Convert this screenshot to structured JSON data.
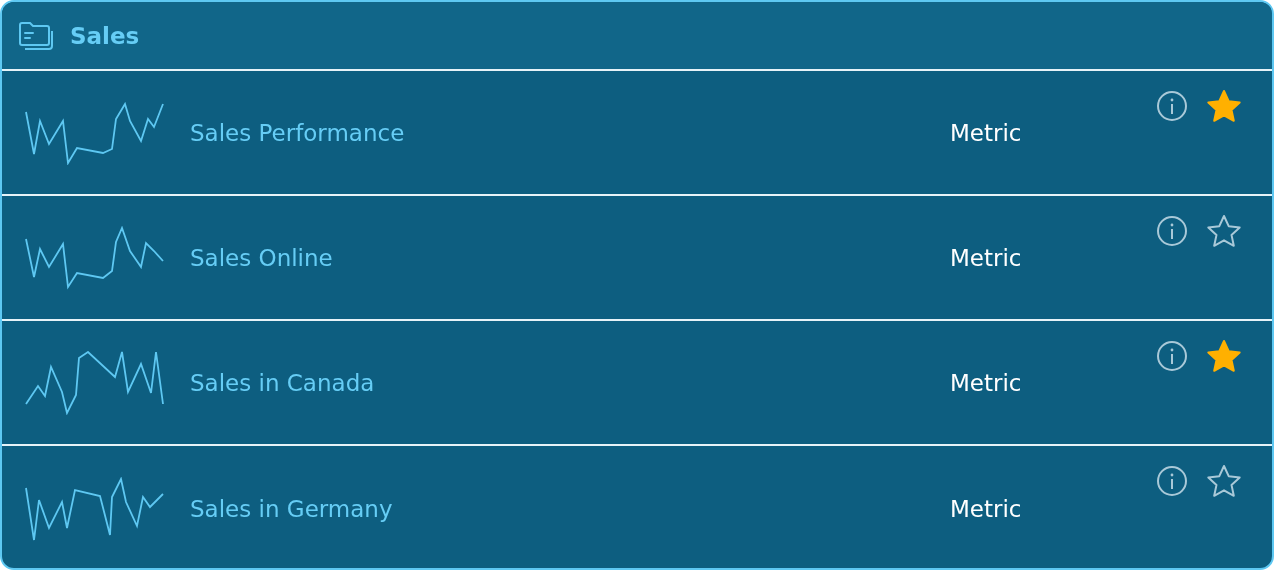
{
  "header": {
    "title": "Sales"
  },
  "items": [
    {
      "name": "Sales Performance",
      "type": "Metric",
      "favorite": true
    },
    {
      "name": "Sales Online",
      "type": "Metric",
      "favorite": false
    },
    {
      "name": "Sales in Canada",
      "type": "Metric",
      "favorite": true
    },
    {
      "name": "Sales in Germany",
      "type": "Metric",
      "favorite": false
    }
  ]
}
